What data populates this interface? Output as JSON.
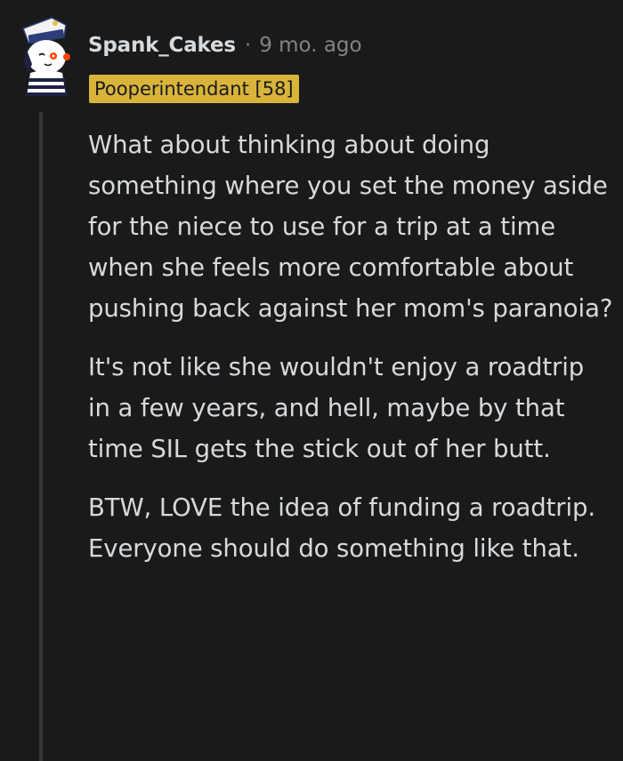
{
  "comment": {
    "author": "Spank_Cakes",
    "separator": "·",
    "timestamp": "9 mo. ago",
    "flair": "Pooperintendant [58]",
    "paragraphs": [
      "What about thinking about doing something where you set the money aside for the niece to use for a trip at a time when she feels more comfortable about pushing back against her mom's paranoia?",
      "It's not like she wouldn't enjoy a roadtrip in a few years, and hell, maybe by that time SIL gets the stick out of her butt.",
      "BTW, LOVE the idea of funding a roadtrip. Everyone should do something like that."
    ]
  },
  "colors": {
    "background": "#1a1a1b",
    "text": "#d7dadc",
    "meta": "#818384",
    "flair_bg": "#d8b43a",
    "thread_line": "#343536"
  },
  "icons": {
    "avatar": "snoo-sailor-avatar"
  }
}
